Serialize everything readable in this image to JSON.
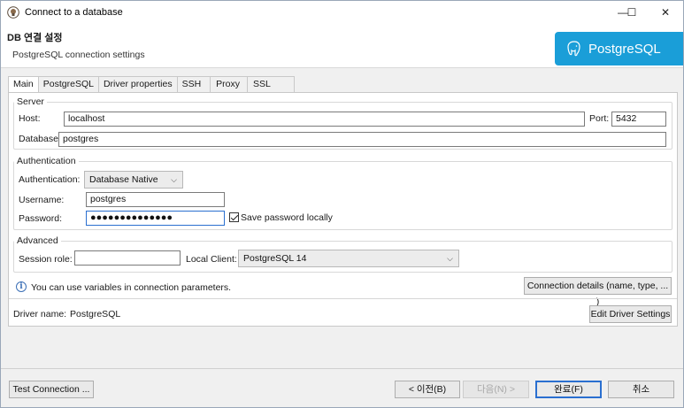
{
  "window": {
    "title": "Connect to a database",
    "min_glyph": "—",
    "max_glyph": "☐",
    "close_glyph": "✕"
  },
  "header": {
    "title": "DB 연결 설정",
    "subtitle": "PostgreSQL connection settings",
    "logo_text": "PostgreSQL"
  },
  "tabs": [
    "Main",
    "PostgreSQL",
    "Driver properties",
    "SSH",
    "Proxy",
    "SSL"
  ],
  "server": {
    "legend": "Server",
    "host_label": "Host:",
    "host_value": "localhost",
    "port_label": "Port:",
    "port_value": "5432",
    "database_label": "Database:",
    "database_value": "postgres"
  },
  "auth": {
    "legend": "Authentication",
    "auth_label": "Authentication:",
    "auth_value": "Database Native",
    "username_label": "Username:",
    "username_value": "postgres",
    "password_label": "Password:",
    "password_value": "●●●●●●●●●●●●●●",
    "save_password_label": "Save password locally"
  },
  "advanced": {
    "legend": "Advanced",
    "session_role_label": "Session role:",
    "session_role_value": "",
    "local_client_label": "Local Client:",
    "local_client_value": "PostgreSQL 14"
  },
  "info_text": "You can use variables in connection parameters.",
  "connection_details_button": "Connection details (name, type, ... )",
  "driver_name_label": "Driver name:",
  "driver_name_value": "PostgreSQL",
  "edit_driver_button": "Edit Driver Settings",
  "footer": {
    "test_connection": "Test Connection ...",
    "back": "< 이전(B)",
    "next": "다음(N) >",
    "finish": "완료(F)",
    "cancel": "취소"
  },
  "colors": {
    "logo_bg": "#1a9ed8",
    "focus_border": "#2a6fd0"
  },
  "icons": {
    "app": "dbeaver-beaver-icon",
    "info": "info-icon",
    "logo": "postgresql-elephant-icon"
  }
}
